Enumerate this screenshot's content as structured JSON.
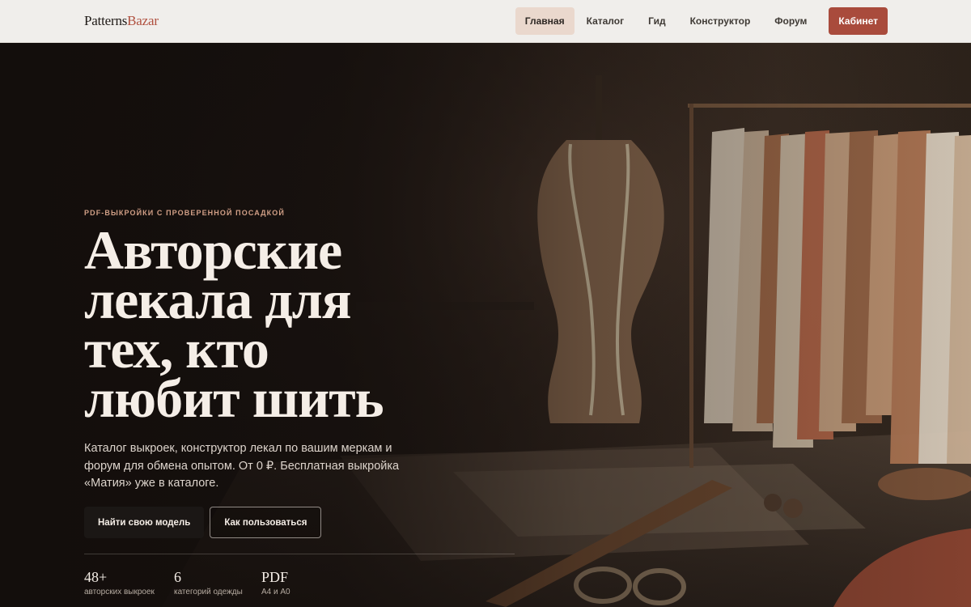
{
  "header": {
    "logo_part1": "Patterns",
    "logo_part2": "Bazar",
    "nav": [
      "Главная",
      "Каталог",
      "Гид",
      "Конструктор",
      "Форум"
    ],
    "cta": "Кабинет"
  },
  "hero": {
    "eyebrow": "PDF-выкройки с проверенной посадкой",
    "headline": [
      "Авторские",
      "лекала для",
      "тех, кто",
      "любит шить"
    ],
    "subtitle": "Каталог выкроек, конструктор лекал по вашим меркам и форум для обмена опытом. От 0 ₽. Бесплатная выкройка «Матия» уже в каталоге.",
    "primary_button": "Найти свою модель",
    "secondary_button": "Как пользоваться",
    "stats": [
      {
        "value": "48+",
        "label": "авторских выкроек"
      },
      {
        "value": "6",
        "label": "категорий одежды"
      },
      {
        "value": "PDF",
        "label": "А4 и А0"
      }
    ]
  },
  "colors": {
    "accent": "#a94b3c",
    "eyebrow": "#d19f86",
    "header_bg": "#f0eeeb",
    "active_nav_bg": "#ead8cd"
  },
  "icons": []
}
